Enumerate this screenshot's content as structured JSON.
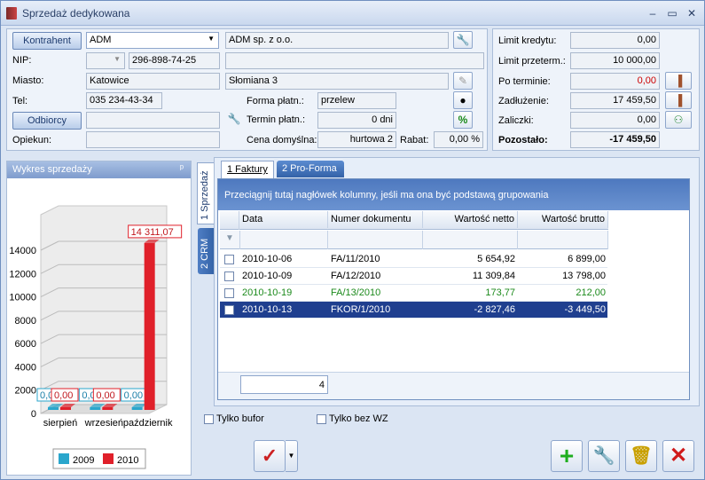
{
  "window": {
    "title": "Sprzedaż dedykowana",
    "minimize": "‒",
    "maximize": "▭",
    "close": "✕"
  },
  "contractor": {
    "kontrahent_button": "Kontrahent",
    "code": "ADM",
    "name": "ADM sp. z o.o.",
    "nip_label": "NIP:",
    "nip": "296-898-74-25",
    "miasto_label": "Miasto:",
    "miasto": "Katowice",
    "ulica": "Słomiana 3",
    "tel_label": "Tel:",
    "tel": "035 234-43-34",
    "forma_label": "Forma  płatn.:",
    "forma": "przelew",
    "odbiorcy_button": "Odbiorcy",
    "termin_label": "Termin płatn.:",
    "termin": "0 dni",
    "opiekun_label": "Opiekun:",
    "cena_label": "Cena domyślna:",
    "cena": "hurtowa 2",
    "rabat_label": "Rabat:",
    "rabat": "0,00 %"
  },
  "finance": {
    "limit_kredytu_label": "Limit kredytu:",
    "limit_kredytu": "0,00",
    "limit_przeterm_label": "Limit przeterm.:",
    "limit_przeterm": "10 000,00",
    "po_terminie_label": "Po terminie:",
    "po_terminie": "0,00",
    "zadluzenie_label": "Zadłużenie:",
    "zadluzenie": "17 459,50",
    "zaliczki_label": "Zaliczki:",
    "zaliczki": "0,00",
    "pozostalo_label": "Pozostało:",
    "pozostalo": "-17 459,50"
  },
  "chart_panel": {
    "title": "Wykres sprzedaży",
    "pin": "ᵖ"
  },
  "chart_data": {
    "type": "bar",
    "categories": [
      "sierpień",
      "wrzesień",
      "październik"
    ],
    "series": [
      {
        "name": "2009",
        "values": [
          0,
          0,
          0
        ],
        "color": "#2aa6cc"
      },
      {
        "name": "2010",
        "values": [
          0,
          0,
          14311.07
        ],
        "color": "#e0202a"
      }
    ],
    "data_labels": [
      [
        "0,00",
        "0,00"
      ],
      [
        "0,00",
        "0,00"
      ],
      [
        "0,00",
        "14 311,07"
      ]
    ],
    "ylim": [
      0,
      14000
    ],
    "yticks": [
      "0",
      "2000",
      "4000",
      "6000",
      "8000",
      "10000",
      "12000",
      "14000"
    ],
    "legend": "bottom"
  },
  "vtabs": [
    {
      "label": "1 Sprzedaż"
    },
    {
      "label": "2 CRM"
    }
  ],
  "tabs": [
    {
      "label": "1 Faktury"
    },
    {
      "label": "2 Pro-Forma"
    }
  ],
  "grid": {
    "group_hint": "Przeciągnij tutaj nagłówek kolumny, jeśli ma ona być podstawą grupowania",
    "columns": [
      "Data",
      "Numer dokumentu",
      "Wartość netto",
      "Wartość brutto"
    ],
    "rows": [
      {
        "date": "2010-10-06",
        "number": "FA/11/2010",
        "netto": "5 654,92",
        "brutto": "6 899,00"
      },
      {
        "date": "2010-10-09",
        "number": "FA/12/2010",
        "netto": "11 309,84",
        "brutto": "13 798,00"
      },
      {
        "date": "2010-10-19",
        "number": "FA/13/2010",
        "netto": "173,77",
        "brutto": "212,00"
      },
      {
        "date": "2010-10-13",
        "number": "FKOR/1/2010",
        "netto": "-2 827,46",
        "brutto": "-3 449,50"
      }
    ],
    "count": "4"
  },
  "options": {
    "tylko_bufor": "Tylko bufor",
    "tylko_bez_wz": "Tylko bez WZ"
  },
  "colors": {
    "selected_row": "#1f3f8f",
    "green_text": "#1c8a1c",
    "red_text": "#cc0000"
  }
}
